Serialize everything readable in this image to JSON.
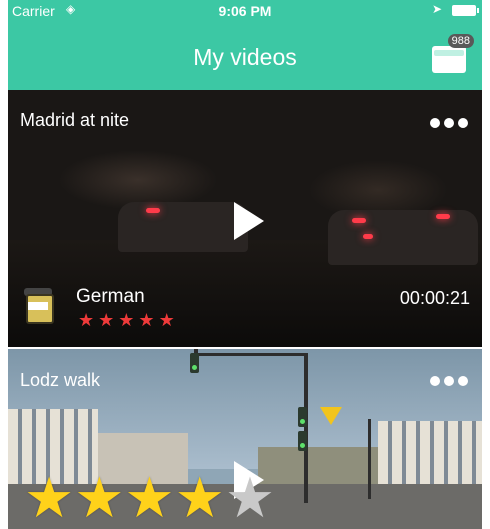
{
  "status_bar": {
    "carrier": "Carrier",
    "time": "9:06 PM"
  },
  "header": {
    "title": "My videos",
    "wallet_badge": "988"
  },
  "colors": {
    "header": "#3cc8a4",
    "star_small": "#ef3a3a",
    "star_large": "#ffd21a"
  },
  "videos": [
    {
      "title": "Madrid at nite",
      "language": "German",
      "duration": "00:00:21",
      "rating": 5,
      "rating_max": 5
    },
    {
      "title": "Lodz walk",
      "rating": 4,
      "rating_max": 5
    }
  ]
}
